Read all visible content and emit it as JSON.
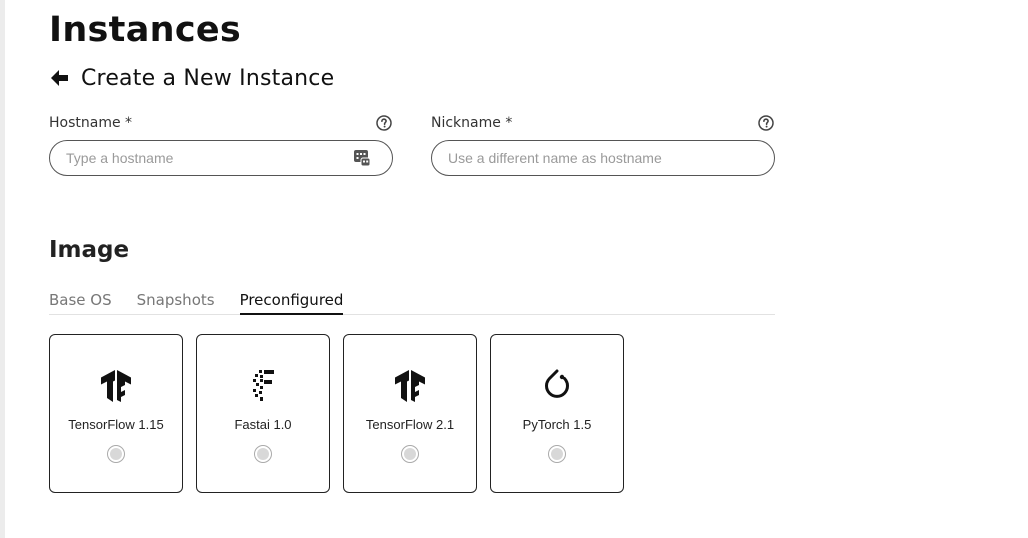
{
  "page": {
    "title": "Instances",
    "subtitle": "Create a New Instance",
    "back_icon": "arrow-left-icon"
  },
  "form": {
    "hostname": {
      "label": "Hostname *",
      "placeholder": "Type a hostname",
      "value": "",
      "help_icon": "question-circle-icon",
      "trailing_icon": "random-name-generator-icon"
    },
    "nickname": {
      "label": "Nickname *",
      "placeholder": "Use a different name as hostname",
      "value": "",
      "help_icon": "question-circle-icon"
    }
  },
  "image": {
    "section_title": "Image",
    "tabs": [
      {
        "label": "Base OS",
        "active": false
      },
      {
        "label": "Snapshots",
        "active": false
      },
      {
        "label": "Preconfigured",
        "active": true
      }
    ],
    "cards": [
      {
        "label": "TensorFlow 1.15",
        "icon": "tensorflow-icon",
        "selected": false
      },
      {
        "label": "Fastai 1.0",
        "icon": "fastai-icon",
        "selected": false
      },
      {
        "label": "TensorFlow 2.1",
        "icon": "tensorflow-icon",
        "selected": false
      },
      {
        "label": "PyTorch 1.5",
        "icon": "pytorch-icon",
        "selected": false
      }
    ]
  },
  "colors": {
    "text": "#111111",
    "border": "#222222",
    "muted_tab": "#777777",
    "placeholder": "#9a9a9a",
    "radio_fill": "#d8d8d8"
  }
}
